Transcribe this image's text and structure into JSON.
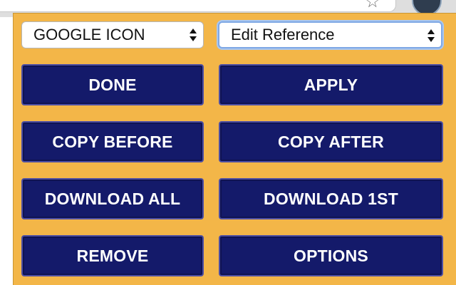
{
  "browser": {
    "icons": [
      "star-icon",
      "extension-icon"
    ]
  },
  "popup": {
    "background": "#f3b648",
    "button_color": "#141a6a",
    "selects": {
      "icon_source": {
        "value": "GOOGLE ICON"
      },
      "mode": {
        "value": "Edit Reference"
      }
    },
    "buttons": {
      "done": "DONE",
      "apply": "APPLY",
      "copy_before": "COPY BEFORE",
      "copy_after": "COPY AFTER",
      "download_all": "DOWNLOAD ALL",
      "download_1st": "DOWNLOAD 1ST",
      "remove": "REMOVE",
      "options": "OPTIONS"
    }
  }
}
